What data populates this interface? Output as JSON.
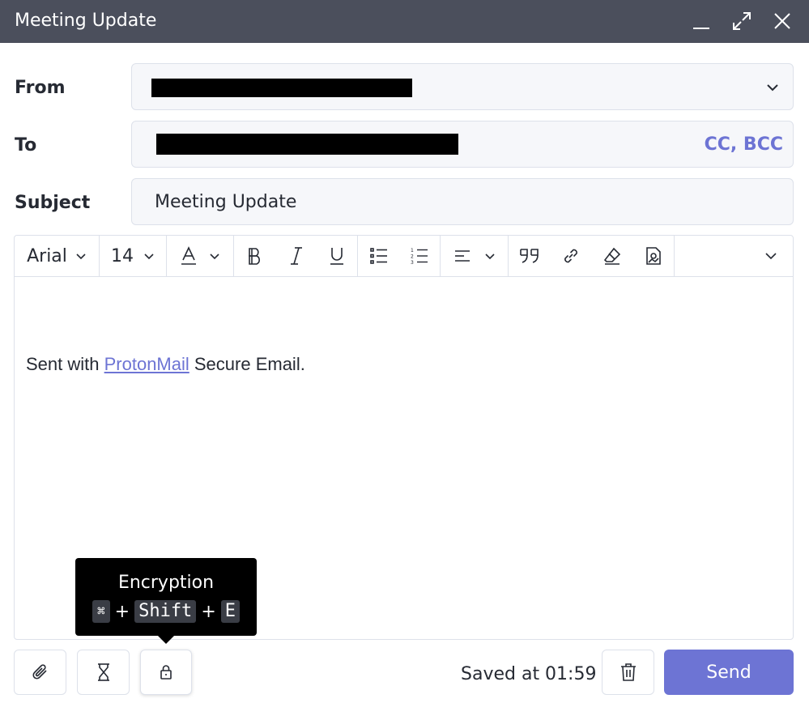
{
  "window": {
    "title": "Meeting Update",
    "minimize_icon": "minimize-icon",
    "maximize_icon": "maximize-icon",
    "close_icon": "close-icon"
  },
  "fields": {
    "from_label": "From",
    "to_label": "To",
    "cc_bcc": "CC, BCC",
    "subject_label": "Subject",
    "subject_value": "Meeting Update"
  },
  "toolbar": {
    "font_family": "Arial",
    "font_size": "14",
    "icons": [
      "text-color-icon",
      "bold-icon",
      "italic-icon",
      "underline-icon",
      "bullet-list-icon",
      "numbered-list-icon",
      "align-icon",
      "quote-icon",
      "link-icon",
      "eraser-icon",
      "insert-image-icon",
      "more-chevron-icon"
    ]
  },
  "body": {
    "prefix": "Sent with ",
    "link": "ProtonMail",
    "suffix": " Secure Email."
  },
  "tooltip": {
    "title": "Encryption",
    "key1": "⌘",
    "plus1": "+",
    "key2": "Shift",
    "plus2": "+",
    "key3": "E"
  },
  "footer": {
    "saved": "Saved at 01:59",
    "send": "Send"
  },
  "colors": {
    "titlebar": "#4b4f5c",
    "accent": "#6d74d4"
  }
}
